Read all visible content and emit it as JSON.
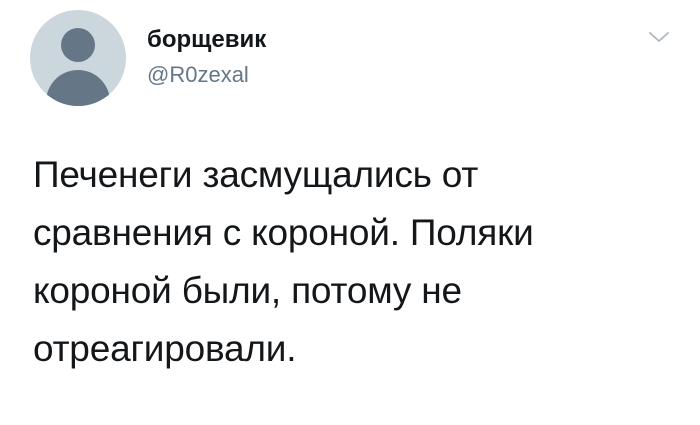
{
  "author": {
    "display_name": "борщевик",
    "handle": "@R0zexal",
    "avatar_icon": "default-profile-icon",
    "avatar_bg": "#ccd6dd",
    "avatar_fg": "#657786"
  },
  "menu": {
    "icon": "chevron-down-icon"
  },
  "tweet": {
    "text": "Печенеги засмущались от\nсравнения с короной. Поляки\nкороной были, потому не\nотреагировали."
  }
}
